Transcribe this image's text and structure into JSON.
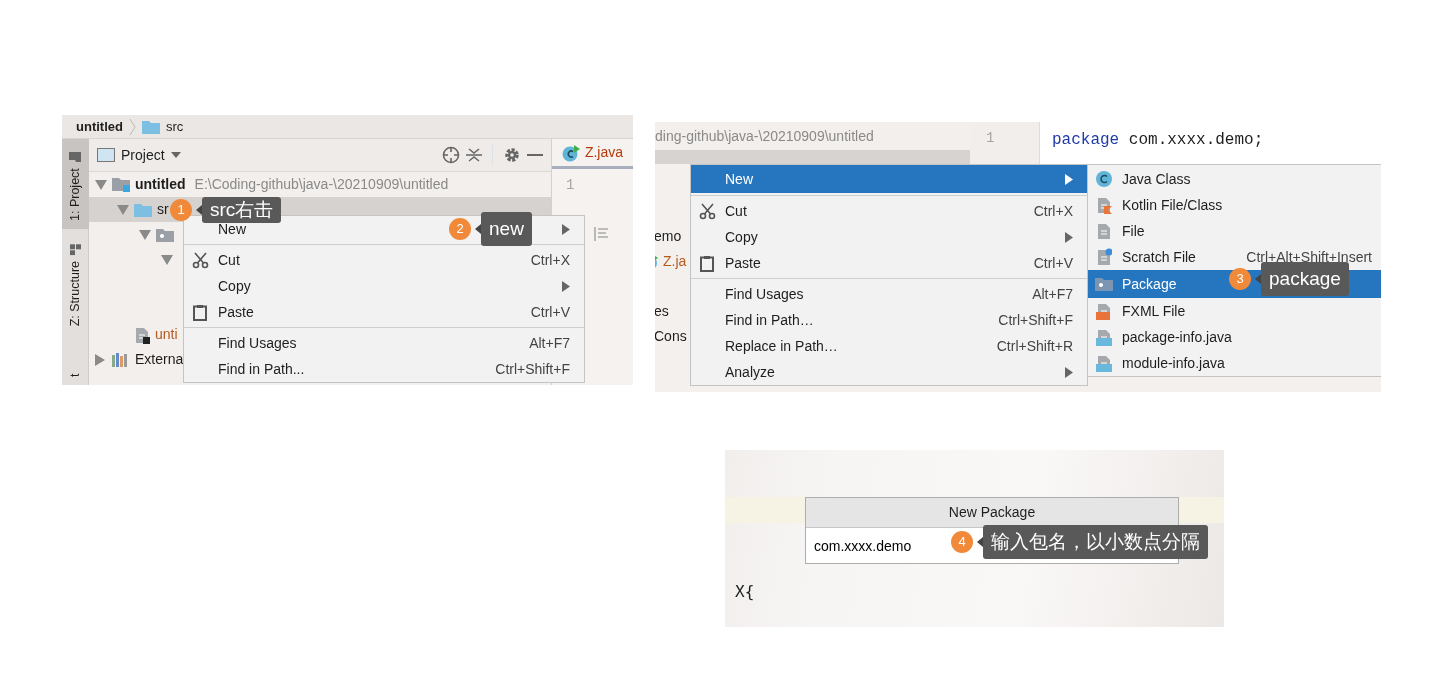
{
  "panel_1": {
    "breadcrumbs": [
      "untitled",
      "src"
    ],
    "side_tabs": [
      {
        "label": "1: Project",
        "selected": true
      },
      {
        "label": "Z: Structure",
        "selected": false
      },
      {
        "label": "t",
        "selected": false
      }
    ],
    "project_header": "Project",
    "tree": [
      {
        "name": "untitled",
        "path": "E:\\Coding-github\\java-\\20210909\\untitled",
        "kind": "module",
        "expanded": true,
        "selected": false,
        "children": [
          {
            "name": "sr",
            "kind": "source",
            "expanded": true,
            "selected": true,
            "children": [
              {
                "kind": "package",
                "expanded": true,
                "selected": false,
                "children": [
                  {
                    "expanded": true,
                    "selected": false
                  }
                ]
              }
            ]
          },
          {
            "name": "unti",
            "kind": "iml",
            "selected": false
          }
        ]
      },
      {
        "name": "Externa",
        "kind": "libraries",
        "expanded": false,
        "selected": false
      }
    ],
    "editor_tab": "Z.java",
    "line_numbers": [
      "1"
    ],
    "context_menu": [
      {
        "label": "New",
        "kind": "plain",
        "submenu": true,
        "selected": false
      },
      {
        "label": "Cut",
        "kind": "cut",
        "shortcut": "Ctrl+X",
        "submenu": false,
        "selected": false
      },
      {
        "label": "Copy",
        "kind": "plain",
        "submenu": true,
        "selected": false
      },
      {
        "label": "Paste",
        "kind": "paste",
        "shortcut": "Ctrl+V",
        "submenu": false,
        "selected": false
      },
      {
        "label": "Find Usages",
        "kind": "plain",
        "shortcut": "Alt+F7",
        "submenu": false,
        "selected": false
      },
      {
        "label": "Find in Path...",
        "kind": "plain",
        "shortcut": "Ctrl+Shift+F",
        "submenu": false,
        "selected": false
      }
    ],
    "callouts": [
      {
        "number": "1",
        "text": "src右击"
      },
      {
        "number": "2",
        "text": "new"
      }
    ]
  },
  "panel_2": {
    "path": "ding-github\\java-\\20210909\\untitled",
    "line_numbers": [
      "1"
    ],
    "code": {
      "keyword": "package",
      "text": "com.xxxx.demo;"
    },
    "tree_fragments": [
      {
        "name": "emo",
        "kind": "text"
      },
      {
        "name": "Z.ja",
        "kind": "class"
      },
      {
        "name": "es",
        "kind": "text"
      },
      {
        "name": "Cons",
        "kind": "text"
      }
    ],
    "context_menu": [
      {
        "label": "New",
        "kind": "plain",
        "submenu": true,
        "selected": true
      },
      {
        "label": "Cut",
        "kind": "cut",
        "shortcut": "Ctrl+X",
        "submenu": false,
        "selected": false
      },
      {
        "label": "Copy",
        "kind": "plain",
        "submenu": true,
        "selected": false
      },
      {
        "label": "Paste",
        "kind": "paste",
        "shortcut": "Ctrl+V",
        "submenu": false,
        "selected": false
      },
      {
        "label": "Find Usages",
        "kind": "plain",
        "shortcut": "Alt+F7",
        "submenu": false,
        "selected": false
      },
      {
        "label": "Find in Path…",
        "kind": "plain",
        "shortcut": "Ctrl+Shift+F",
        "submenu": false,
        "selected": false
      },
      {
        "label": "Replace in Path…",
        "kind": "plain",
        "shortcut": "Ctrl+Shift+R",
        "submenu": false,
        "selected": false
      },
      {
        "label": "Analyze",
        "kind": "plain",
        "submenu": true,
        "selected": false
      }
    ],
    "new_submenu": [
      {
        "label": "Java Class",
        "kind": "java-class",
        "selected": false
      },
      {
        "label": "Kotlin File/Class",
        "kind": "kotlin",
        "selected": false
      },
      {
        "label": "File",
        "kind": "file",
        "selected": false
      },
      {
        "label": "Scratch File",
        "kind": "scratch",
        "shortcut": "Ctrl+Alt+Shift+Insert",
        "selected": false
      },
      {
        "label": "Package",
        "kind": "package",
        "selected": true
      },
      {
        "label": "FXML File",
        "kind": "fxml",
        "selected": false
      },
      {
        "label": "package-info.java",
        "kind": "java-file",
        "selected": false
      },
      {
        "label": "module-info.java",
        "kind": "java-file",
        "selected": false
      }
    ],
    "callouts": [
      {
        "number": "3",
        "text": "package"
      }
    ]
  },
  "panel_3": {
    "dialog": {
      "title": "New Package",
      "value": "com.xxxx.demo"
    },
    "code": "X{",
    "callouts": [
      {
        "number": "4",
        "text": "输入包名，以小数点分隔"
      }
    ]
  }
}
